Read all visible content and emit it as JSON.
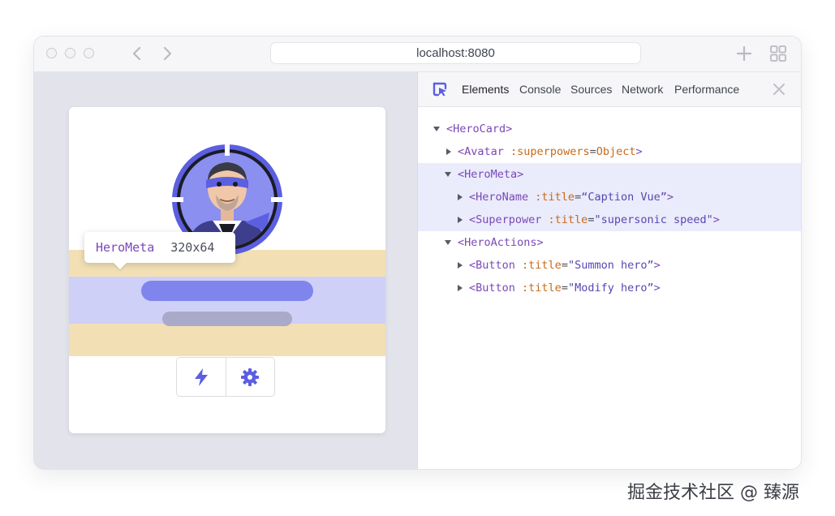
{
  "browser": {
    "url": "localhost:8080"
  },
  "tooltip": {
    "component": "HeroMeta",
    "size": "320x64"
  },
  "hero_card": {
    "actions": [
      {
        "icon": "lightning-icon"
      },
      {
        "icon": "gear-icon"
      }
    ]
  },
  "devtools": {
    "tabs": [
      "Elements",
      "Console",
      "Sources",
      "Network",
      "Performance"
    ],
    "active_tab": "Elements",
    "tree": [
      {
        "tag": "<HeroCard>",
        "attr": "",
        "value": "",
        "expanded": true
      },
      {
        "tag": "<Avatar",
        "attr": ":superpowers",
        "value": "Object",
        "close": ">",
        "expanded": false
      },
      {
        "tag": "<HeroMeta>",
        "attr": "",
        "value": "",
        "expanded": true
      },
      {
        "tag": "<HeroName",
        "attr": ":title",
        "value": "“Caption Vue”",
        "close": ">",
        "expanded": false
      },
      {
        "tag": "<Superpower",
        "attr": ":title",
        "value": "\"supersonic speed\"",
        "close": ">",
        "expanded": false
      },
      {
        "tag": "<HeroActions>",
        "attr": "",
        "value": "",
        "expanded": true
      },
      {
        "tag": "<Button",
        "attr": ":title",
        "value": "\"Summon hero”",
        "close": ">",
        "expanded": false
      },
      {
        "tag": "<Button",
        "attr": ":title",
        "value": "\"Modify hero”",
        "close": ">",
        "expanded": false
      }
    ]
  },
  "watermark": "掘金技术社区 @ 臻源",
  "colors": {
    "accent": "#5b5fe0",
    "highlight_row": "#eaebfb",
    "tag": "#7a48b8",
    "attr": "#c76a1a"
  }
}
